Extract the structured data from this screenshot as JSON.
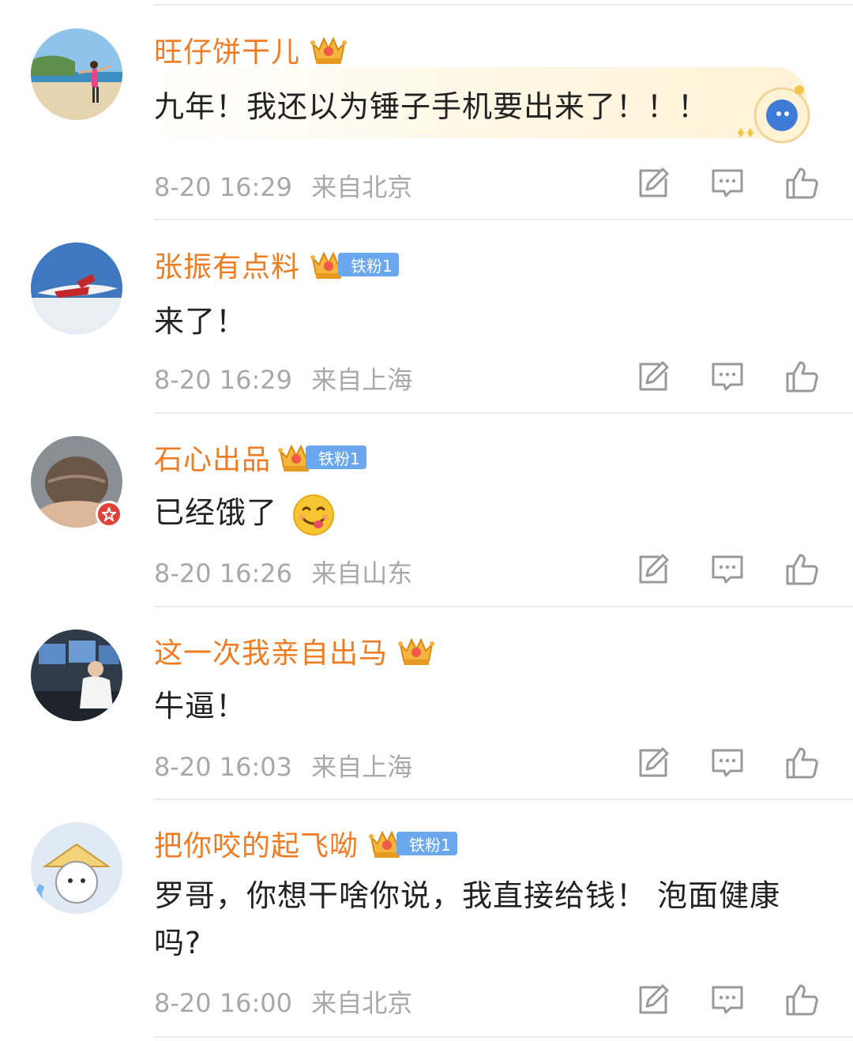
{
  "comments": [
    {
      "username": "旺仔饼干儿",
      "text": "九年！我还以为锤子手机要出来了！！！",
      "time": "8-20 16:29",
      "location": "来自北京",
      "fan_badge": ""
    },
    {
      "username": "张振有点料",
      "text": "来了！",
      "time": "8-20 16:29",
      "location": "来自上海",
      "fan_badge": "铁粉1"
    },
    {
      "username": "石心出品",
      "text": "已经饿了",
      "time": "8-20 16:26",
      "location": "来自山东",
      "fan_badge": "铁粉1"
    },
    {
      "username": "这一次我亲自出马",
      "text": "牛逼！",
      "time": "8-20 16:03",
      "location": "来自上海",
      "fan_badge": ""
    },
    {
      "username": "把你咬的起飞呦",
      "text": "罗哥，你想干啥你说，我直接给钱！ 泡面健康吗?",
      "time": "8-20 16:00",
      "location": "来自北京",
      "fan_badge": "铁粉1"
    }
  ],
  "icons": {
    "repost": "repost-icon",
    "comment": "comment-icon",
    "like": "like-icon",
    "crown": "crown-icon",
    "emoji": "yummy-face-emoji"
  },
  "colors": {
    "username": "#ef7b22",
    "fan_badge": "#6aa7ec",
    "meta": "#a8a8a8"
  }
}
